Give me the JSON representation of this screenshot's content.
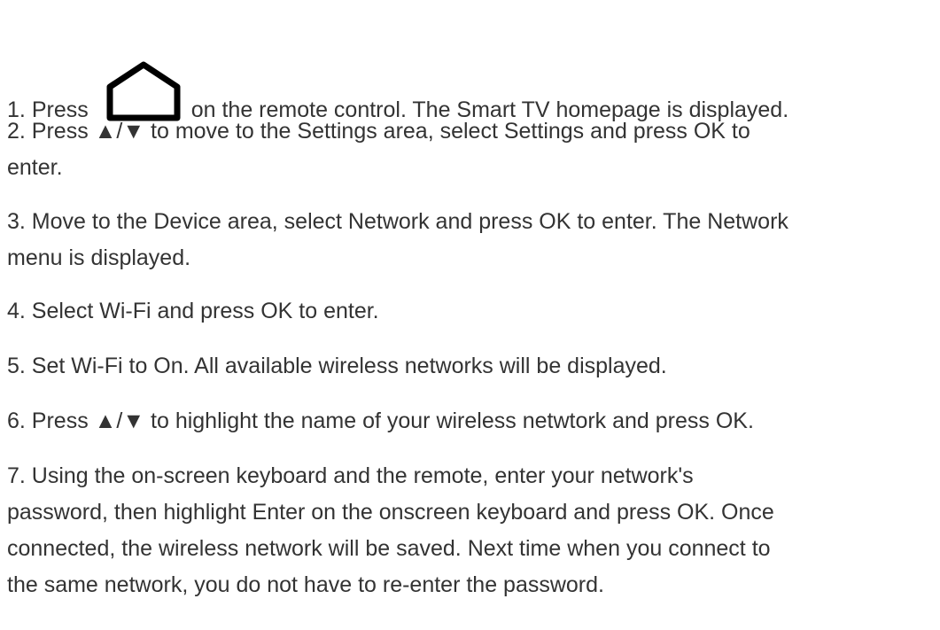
{
  "steps": [
    {
      "number": "1.",
      "before_icon": "Press",
      "icon": "home-icon",
      "after_icon": "on the remote control. The Smart TV homepage is displayed."
    },
    {
      "lines": [
        "2. Press ▲/▼ to move to the Settings area, select Settings and press OK to",
        "enter."
      ]
    },
    {
      "lines": [
        "3. Move to the Device area, select Network and press OK to enter. The Network",
        "menu is displayed."
      ]
    },
    {
      "lines": [
        "4. Select Wi-Fi and press OK to enter."
      ]
    },
    {
      "lines": [
        "5. Set Wi-Fi to On. All available wireless networks will be displayed."
      ]
    },
    {
      "lines": [
        "6. Press ▲/▼ to highlight the name of your wireless netwtork and press OK."
      ]
    },
    {
      "lines": [
        "7. Using the on-screen keyboard and the remote, enter your network's",
        "password, then highlight Enter on the onscreen keyboard and press OK. Once",
        "connected, the wireless network will be saved. Next time when you connect to",
        "the same network, you do not have to re-enter the password."
      ]
    }
  ]
}
